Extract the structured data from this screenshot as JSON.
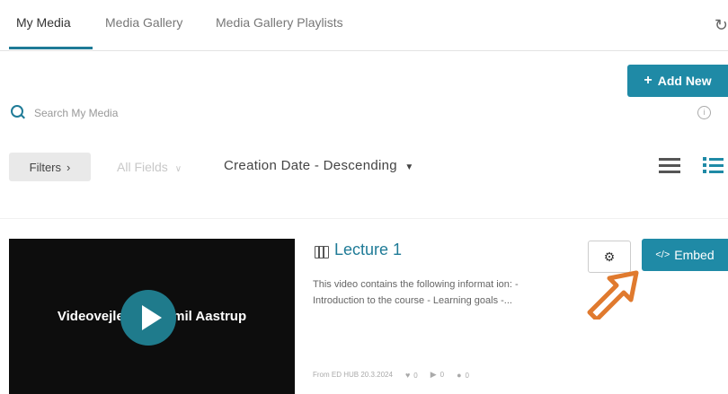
{
  "tabs": [
    {
      "label": "My Media",
      "active": true
    },
    {
      "label": "Media Gallery",
      "active": false
    },
    {
      "label": "Media Gallery Playlists",
      "active": false
    }
  ],
  "toolbar": {
    "add_new_label": "Add New"
  },
  "search": {
    "placeholder": "Search My Media"
  },
  "filters": {
    "filters_label": "Filters",
    "field_select_value": "All Fields",
    "sort_select_value": "Creation Date - Descending"
  },
  "entry": {
    "title": "Lecture 1",
    "thumbnail_text_left": "Videovejledn",
    "thumbnail_text_right": "Emil Aastrup",
    "description": "This video contains the following informat ion: - Introduction to the course - Learning goals -...",
    "from": "From ED HUB 20.3.2024",
    "likes": "0",
    "plays": "0",
    "comments": "0",
    "embed_label": "Embed"
  },
  "colors": {
    "accent": "#1f8aa6",
    "annotation_arrow": "#e07a2e"
  }
}
